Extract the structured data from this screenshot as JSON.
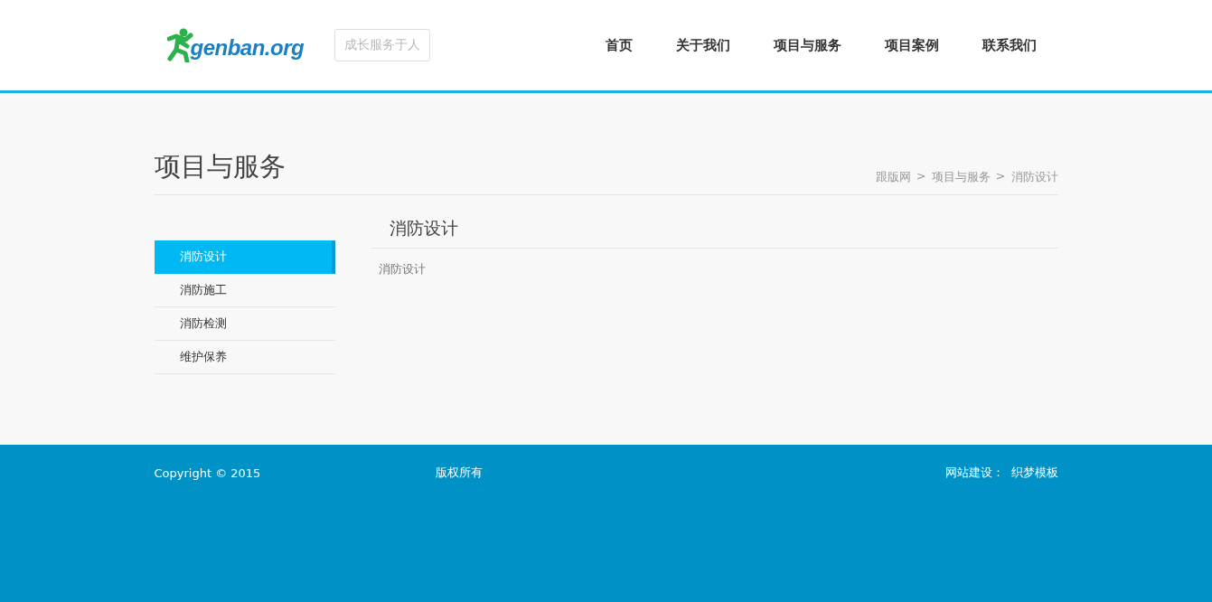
{
  "header": {
    "logo_text": "genban.org",
    "slogan": "成长服务于人",
    "nav": [
      {
        "label": "首页",
        "selected": false
      },
      {
        "label": "关于我们",
        "selected": false
      },
      {
        "label": "项目与服务",
        "selected": false
      },
      {
        "label": "项目案例",
        "selected": false
      },
      {
        "label": "联系我们",
        "selected": false
      }
    ]
  },
  "page_title": "项目与服务",
  "breadcrumb": [
    "跟版网",
    "项目与服务",
    "消防设计"
  ],
  "breadcrumb_separator": ">",
  "sidebar": {
    "items": [
      {
        "label": "消防设计",
        "selected": true
      },
      {
        "label": "消防施工",
        "selected": false
      },
      {
        "label": "消防检测",
        "selected": false
      },
      {
        "label": "维护保养",
        "selected": false
      }
    ]
  },
  "article": {
    "title": "消防设计",
    "body": "消防设计"
  },
  "footer": {
    "copyright": "Copyright © 2015",
    "rights": "版权所有",
    "credit_label": "网站建设：",
    "credit_link": "织梦模板"
  }
}
